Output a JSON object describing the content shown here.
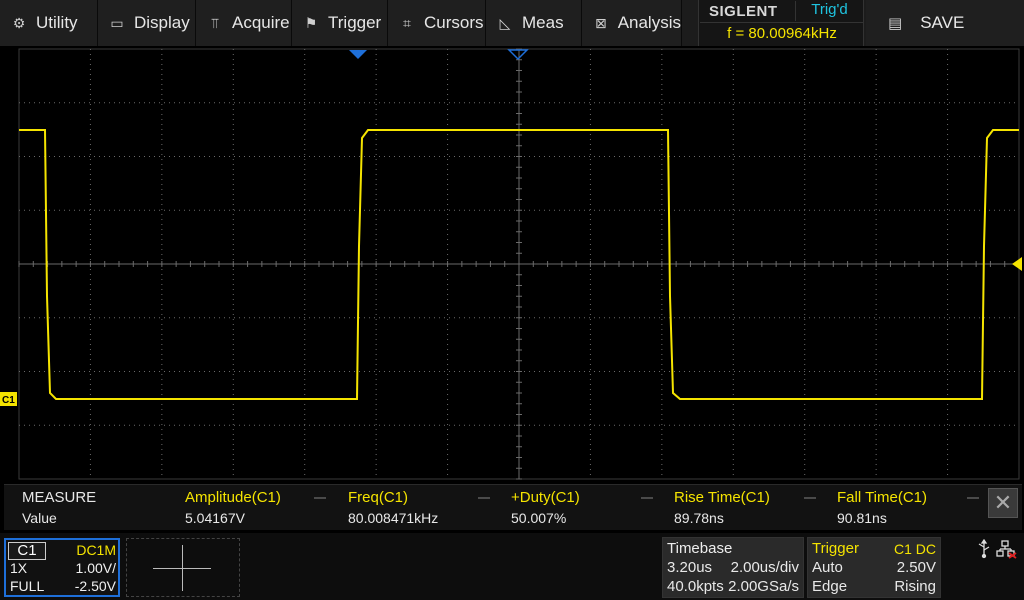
{
  "menu": {
    "items": [
      {
        "label": "Utility",
        "icon": "gear-icon"
      },
      {
        "label": "Display",
        "icon": "monitor-icon"
      },
      {
        "label": "Acquire",
        "icon": "acquire-icon"
      },
      {
        "label": "Trigger",
        "icon": "flag-icon"
      },
      {
        "label": "Cursors",
        "icon": "crosshair-icon"
      },
      {
        "label": "Meas",
        "icon": "measure-ruler-icon"
      },
      {
        "label": "Analysis",
        "icon": "analysis-icon"
      }
    ],
    "brand": "SIGLENT",
    "trig_status": "Trig'd",
    "frequency": "f = 80.00964kHz",
    "save_label": "SAVE",
    "save_icon": "save-icon"
  },
  "measure": {
    "title": "MEASURE",
    "value_label": "Value",
    "columns": [
      {
        "header": "Amplitude(C1)",
        "value": "5.04167V"
      },
      {
        "header": "Freq(C1)",
        "value": "80.008471kHz"
      },
      {
        "header": "+Duty(C1)",
        "value": "50.007%"
      },
      {
        "header": "Rise Time(C1)",
        "value": "89.78ns"
      },
      {
        "header": "Fall Time(C1)",
        "value": "90.81ns"
      }
    ]
  },
  "channel": {
    "name": "C1",
    "coupling": "DC1M",
    "probe": "1X",
    "scale": "1.00V/",
    "bandwidth": "FULL",
    "offset": "-2.50V",
    "marker_label": "C1"
  },
  "timebase": {
    "title": "Timebase",
    "delay": "3.20us",
    "per_div": "2.00us/div",
    "points": "40.0kpts",
    "sample_rate": "2.00GSa/s"
  },
  "trigger": {
    "title": "Trigger",
    "source": "C1 DC",
    "mode": "Auto",
    "level": "2.50V",
    "type": "Edge",
    "slope": "Rising"
  },
  "colors": {
    "trace": "#f5e400",
    "grid": "#6a6a6a",
    "trigger_cyan": "#1fc4e0",
    "marker_blue": "#1e6fd9"
  }
}
